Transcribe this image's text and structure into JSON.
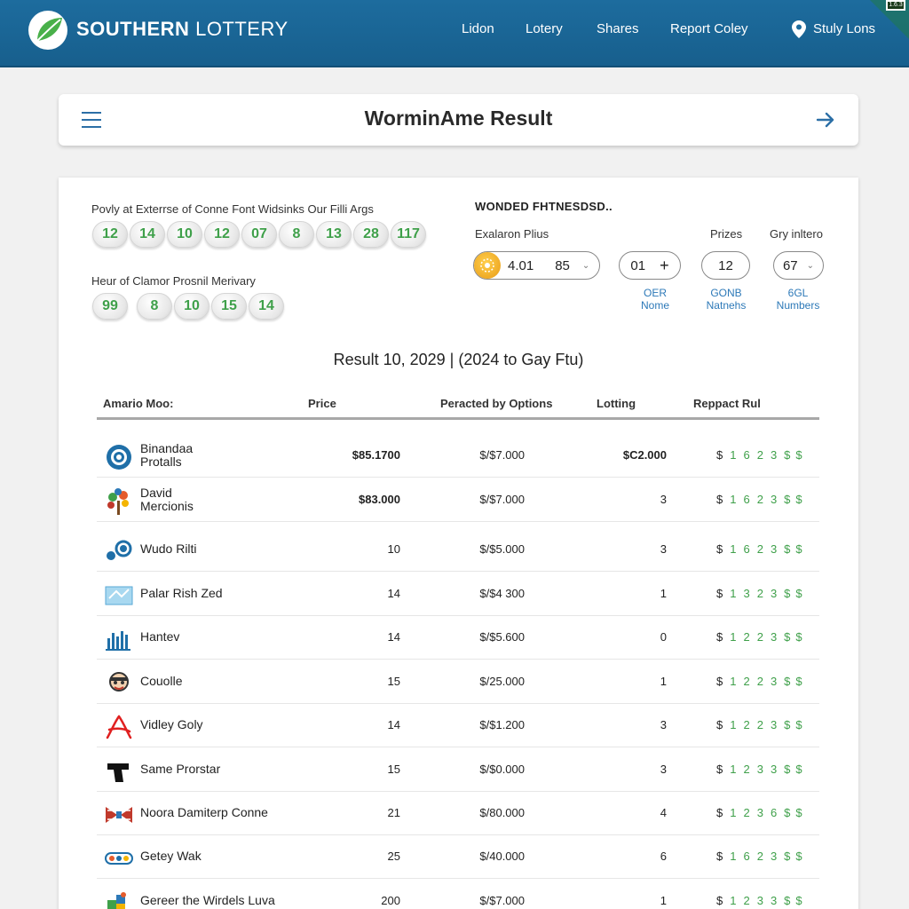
{
  "header": {
    "brand_bold": "SOUTHERN",
    "brand_light": "LOTTERY",
    "nav": [
      "Lidon",
      "Lotery",
      "Shares",
      "Report Coley",
      "Stuly Lons"
    ],
    "badge": "1.6.3",
    "accent": "#1d6c9e"
  },
  "title_card": {
    "title": "WorminAme Result"
  },
  "draws": {
    "caption_1": "Povly at Exterrse of Conne Font Widsinks Our Filli Args",
    "balls_1": [
      "12",
      "14",
      "10",
      "12",
      "07",
      "8",
      "13",
      "28",
      "117"
    ],
    "caption_2": "Heur of Clamor Prosnil Merivary",
    "balls_2": [
      "99",
      "8",
      "10",
      "15",
      "14"
    ]
  },
  "finder": {
    "title": "WONDED FHTNESDSD..",
    "label_left": "Exalaron Plius",
    "label_prizes": "Prizes",
    "label_gry": "Gry inltero",
    "pill_main_a": "4.01",
    "pill_main_b": "85",
    "pill_2": "01",
    "pill_3": "12",
    "pill_4": "67",
    "cap_1": [
      "OER",
      "Nome"
    ],
    "cap_2": [
      "GONB",
      "Natnehs"
    ],
    "cap_3": [
      "6GL",
      "Numbers"
    ]
  },
  "results": {
    "heading": "Result 10, 2029 | (2024 to Gay Ftu)",
    "columns": [
      "Amario Moo:",
      "Price",
      "Peracted by Options",
      "Lotting",
      "Reppact Rul"
    ],
    "rows": [
      {
        "name": [
          "Binandaa",
          "Protalls"
        ],
        "icon": "gear-icon",
        "price": "$85.1700",
        "opt": "$/$7.000",
        "lot": "$C2.000",
        "pay": [
          "1",
          "6",
          "2",
          "3"
        ]
      },
      {
        "name": [
          "David",
          "Mercionis"
        ],
        "icon": "tree-icon",
        "price": "$83.000",
        "opt": "$/$7.000",
        "lot": "3",
        "pay": [
          "1",
          "6",
          "2",
          "3"
        ]
      },
      {
        "name": [
          "Wudo Rilti"
        ],
        "icon": "orbit-icon",
        "price": "10",
        "opt": "$/$5.000",
        "lot": "3",
        "pay": [
          "1",
          "6",
          "2",
          "3"
        ]
      },
      {
        "name": [
          "Palar Rish Zed"
        ],
        "icon": "map-icon",
        "price": "14",
        "opt": "$/$4 300",
        "lot": "1",
        "pay": [
          "1",
          "3",
          "2",
          "3"
        ]
      },
      {
        "name": [
          "Hantev"
        ],
        "icon": "bars-icon",
        "price": "14",
        "opt": "$/$5.600",
        "lot": "0",
        "pay": [
          "1",
          "2",
          "2",
          "3"
        ]
      },
      {
        "name": [
          "Couolle"
        ],
        "icon": "face-icon",
        "price": "15",
        "opt": "$/25.000",
        "lot": "1",
        "pay": [
          "1",
          "2",
          "2",
          "3"
        ]
      },
      {
        "name": [
          "Vidley Goly"
        ],
        "icon": "acrobat-icon",
        "price": "14",
        "opt": "$/$1.200",
        "lot": "3",
        "pay": [
          "1",
          "2",
          "2",
          "3"
        ]
      },
      {
        "name": [
          "Same Prorstar"
        ],
        "icon": "pistol-icon",
        "price": "15",
        "opt": "$/$0.000",
        "lot": "3",
        "pay": [
          "1",
          "2",
          "3",
          "3"
        ]
      },
      {
        "name": [
          "Noora Damiterp Conne"
        ],
        "icon": "bow-icon",
        "price": "21",
        "opt": "$/80.000",
        "lot": "4",
        "pay": [
          "1",
          "2",
          "3",
          "6"
        ]
      },
      {
        "name": [
          "Getey Wak"
        ],
        "icon": "ticket-icon",
        "price": "25",
        "opt": "$/40.000",
        "lot": "6",
        "pay": [
          "1",
          "6",
          "2",
          "3"
        ]
      },
      {
        "name": [
          "Gereer the Wirdels Luva"
        ],
        "icon": "puzzle-icon",
        "price": "200",
        "opt": "$/$7.000",
        "lot": "1",
        "pay": [
          "1",
          "2",
          "3",
          "3"
        ]
      }
    ],
    "dollar": "$",
    "trail": [
      "$",
      "$"
    ]
  }
}
